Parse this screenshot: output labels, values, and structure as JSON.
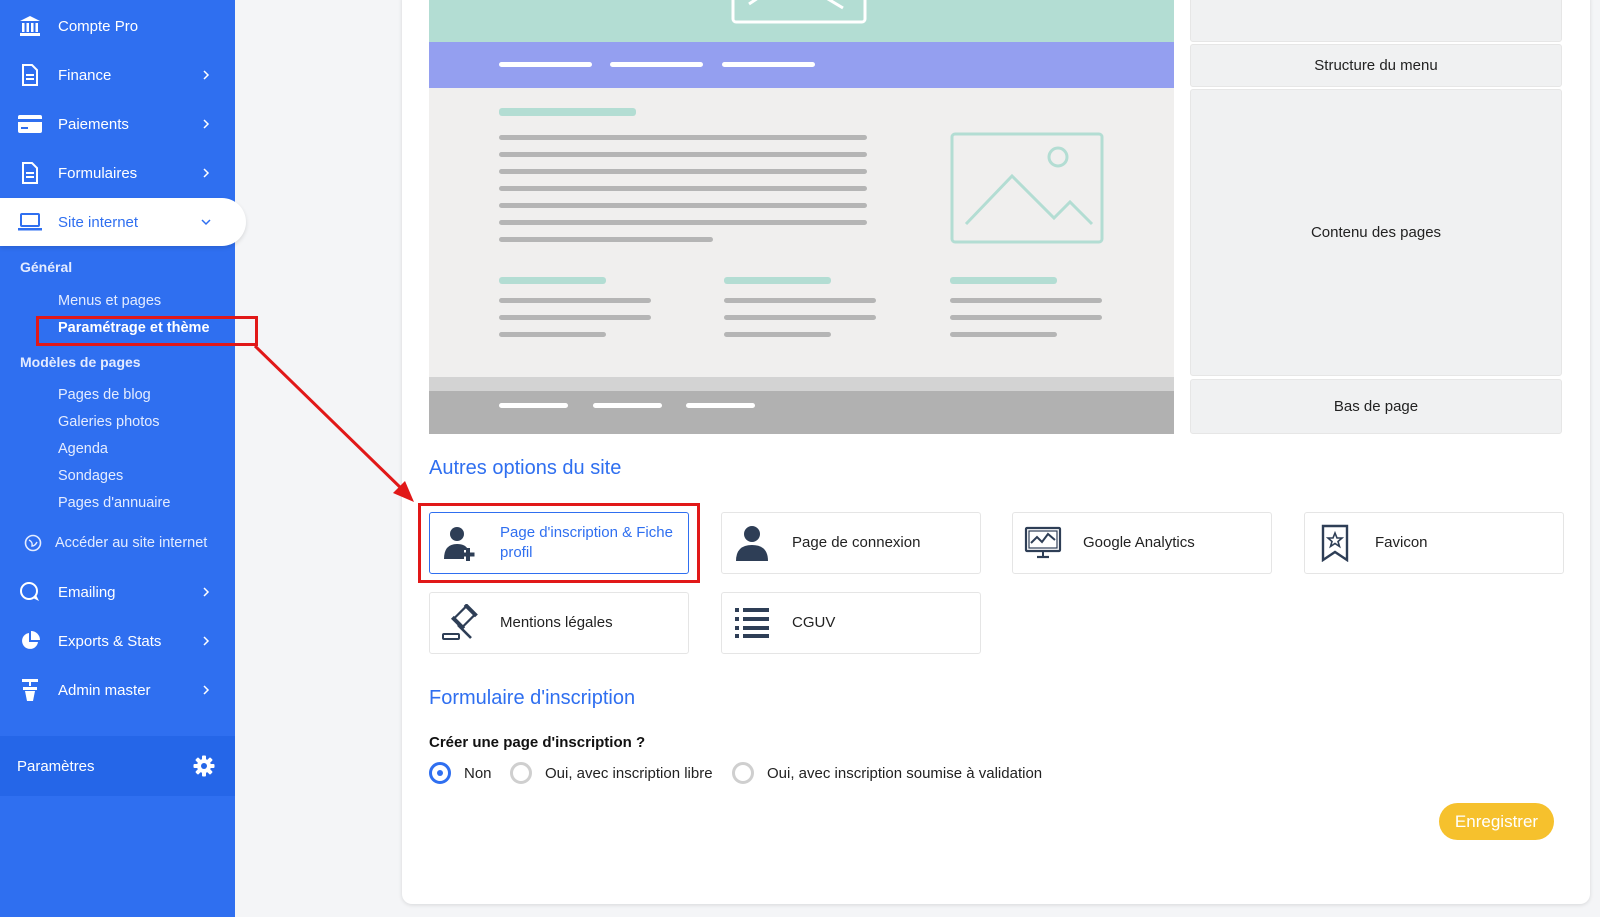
{
  "sidebar": {
    "items": [
      {
        "label": "Compte Pro",
        "icon": "bank-icon"
      },
      {
        "label": "Finance",
        "icon": "document-icon"
      },
      {
        "label": "Paiements",
        "icon": "credit-card-icon"
      },
      {
        "label": "Formulaires",
        "icon": "form-icon"
      },
      {
        "label": "Site internet",
        "icon": "laptop-icon"
      }
    ],
    "general_heading": "Général",
    "general_items": [
      "Menus et pages",
      "Paramétrage et thème"
    ],
    "templates_heading": "Modèles de pages",
    "template_items": [
      "Pages de blog",
      "Galeries photos",
      "Agenda",
      "Sondages",
      "Pages d'annuaire"
    ],
    "access_site": "Accéder au site internet",
    "bottom_items": [
      {
        "label": "Emailing",
        "icon": "chat-icon"
      },
      {
        "label": "Exports & Stats",
        "icon": "pie-chart-icon"
      },
      {
        "label": "Admin master",
        "icon": "admin-icon"
      }
    ],
    "settings_label": "Paramètres"
  },
  "layout_zones": {
    "menu": "Structure du menu",
    "content": "Contenu des pages",
    "footer": "Bas de page"
  },
  "other_options": {
    "heading": "Autres options du site",
    "items": [
      {
        "label": "Page d'inscription & Fiche profil",
        "icon": "user-add-icon"
      },
      {
        "label": "Page de connexion",
        "icon": "user-icon"
      },
      {
        "label": "Google Analytics",
        "icon": "analytics-monitor-icon"
      },
      {
        "label": "Favicon",
        "icon": "bookmark-star-icon"
      },
      {
        "label": "Mentions légales",
        "icon": "gavel-icon"
      },
      {
        "label": "CGUV",
        "icon": "list-icon"
      }
    ]
  },
  "registration_form": {
    "heading": "Formulaire d'inscription",
    "question": "Créer une page d'inscription ?",
    "options": [
      "Non",
      "Oui, avec inscription libre",
      "Oui, avec inscription soumise à validation"
    ],
    "selected": "Non"
  },
  "save_label": "Enregistrer",
  "colors": {
    "sidebar": "#2f6ff0",
    "accent": "#2f6ff0",
    "save": "#f6c12d",
    "highlight": "#e11818"
  }
}
